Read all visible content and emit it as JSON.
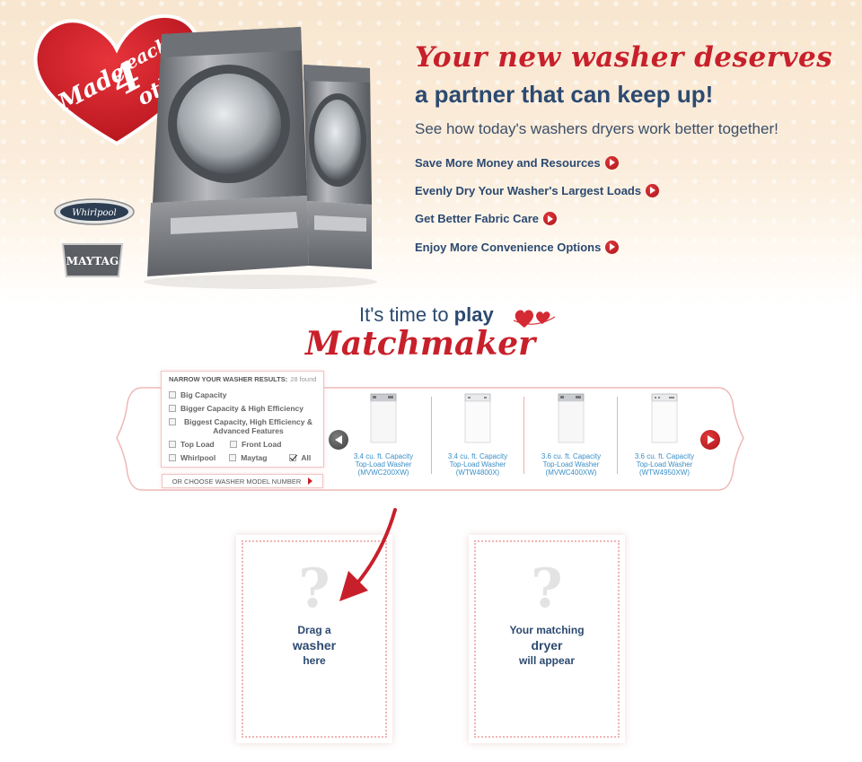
{
  "badge": {
    "line1": "Made",
    "line2": "4",
    "line3": "each",
    "line4": "other"
  },
  "brands": {
    "whirlpool": "Whirlpool",
    "maytag": "MAYTAG"
  },
  "headline": {
    "script": "Your new washer deserves",
    "sub": "a partner that can keep up!",
    "intro": "See how today's washers dryers work better together!"
  },
  "features": [
    {
      "label": "Save More Money and Resources"
    },
    {
      "label": "Evenly Dry Your Washer's Largest Loads"
    },
    {
      "label": "Get Better Fabric Care"
    },
    {
      "label": "Enjoy More Convenience Options"
    }
  ],
  "play": {
    "prefix": "It's time to ",
    "bold": "play",
    "script": "Matchmaker"
  },
  "filters": {
    "heading": "Narrow your washer results:",
    "found": "28 found",
    "options": [
      {
        "label": "Big Capacity",
        "checked": false
      },
      {
        "label": "Bigger Capacity & High Efficiency",
        "checked": false
      },
      {
        "label": "Biggest Capacity, High Efficiency & Advanced Features",
        "checked": false
      }
    ],
    "type_options": [
      {
        "label": "Top Load",
        "checked": false
      },
      {
        "label": "Front Load",
        "checked": false
      }
    ],
    "brand_options": [
      {
        "label": "Whirlpool",
        "checked": false
      },
      {
        "label": "Maytag",
        "checked": false
      },
      {
        "label": "All",
        "checked": true
      }
    ],
    "model_link": "Or choose washer model number"
  },
  "products": [
    {
      "line1": "3.4 cu. ft. Capacity",
      "line2": "Top-Load Washer",
      "model": "(MVWC200XW)"
    },
    {
      "line1": "3.4 cu. ft. Capacity",
      "line2": "Top-Load Washer",
      "model": "(WTW4800X)"
    },
    {
      "line1": "3.6 cu. ft. Capacity",
      "line2": "Top-Load Washer",
      "model": "(MVWC400XW)"
    },
    {
      "line1": "3.6 cu. ft. Capacity",
      "line2": "Top-Load Washer",
      "model": "(WTW4950XW)"
    }
  ],
  "washer_card": {
    "qmark": "?",
    "line1": "Drag a",
    "line2": "washer",
    "line3": "here"
  },
  "dryer_card": {
    "qmark": "?",
    "line1": "Your matching",
    "line2": "dryer",
    "line3": "will appear"
  },
  "colors": {
    "accent_red": "#c8202b",
    "navy": "#2c4a70",
    "link_blue": "#3a8fc7"
  }
}
